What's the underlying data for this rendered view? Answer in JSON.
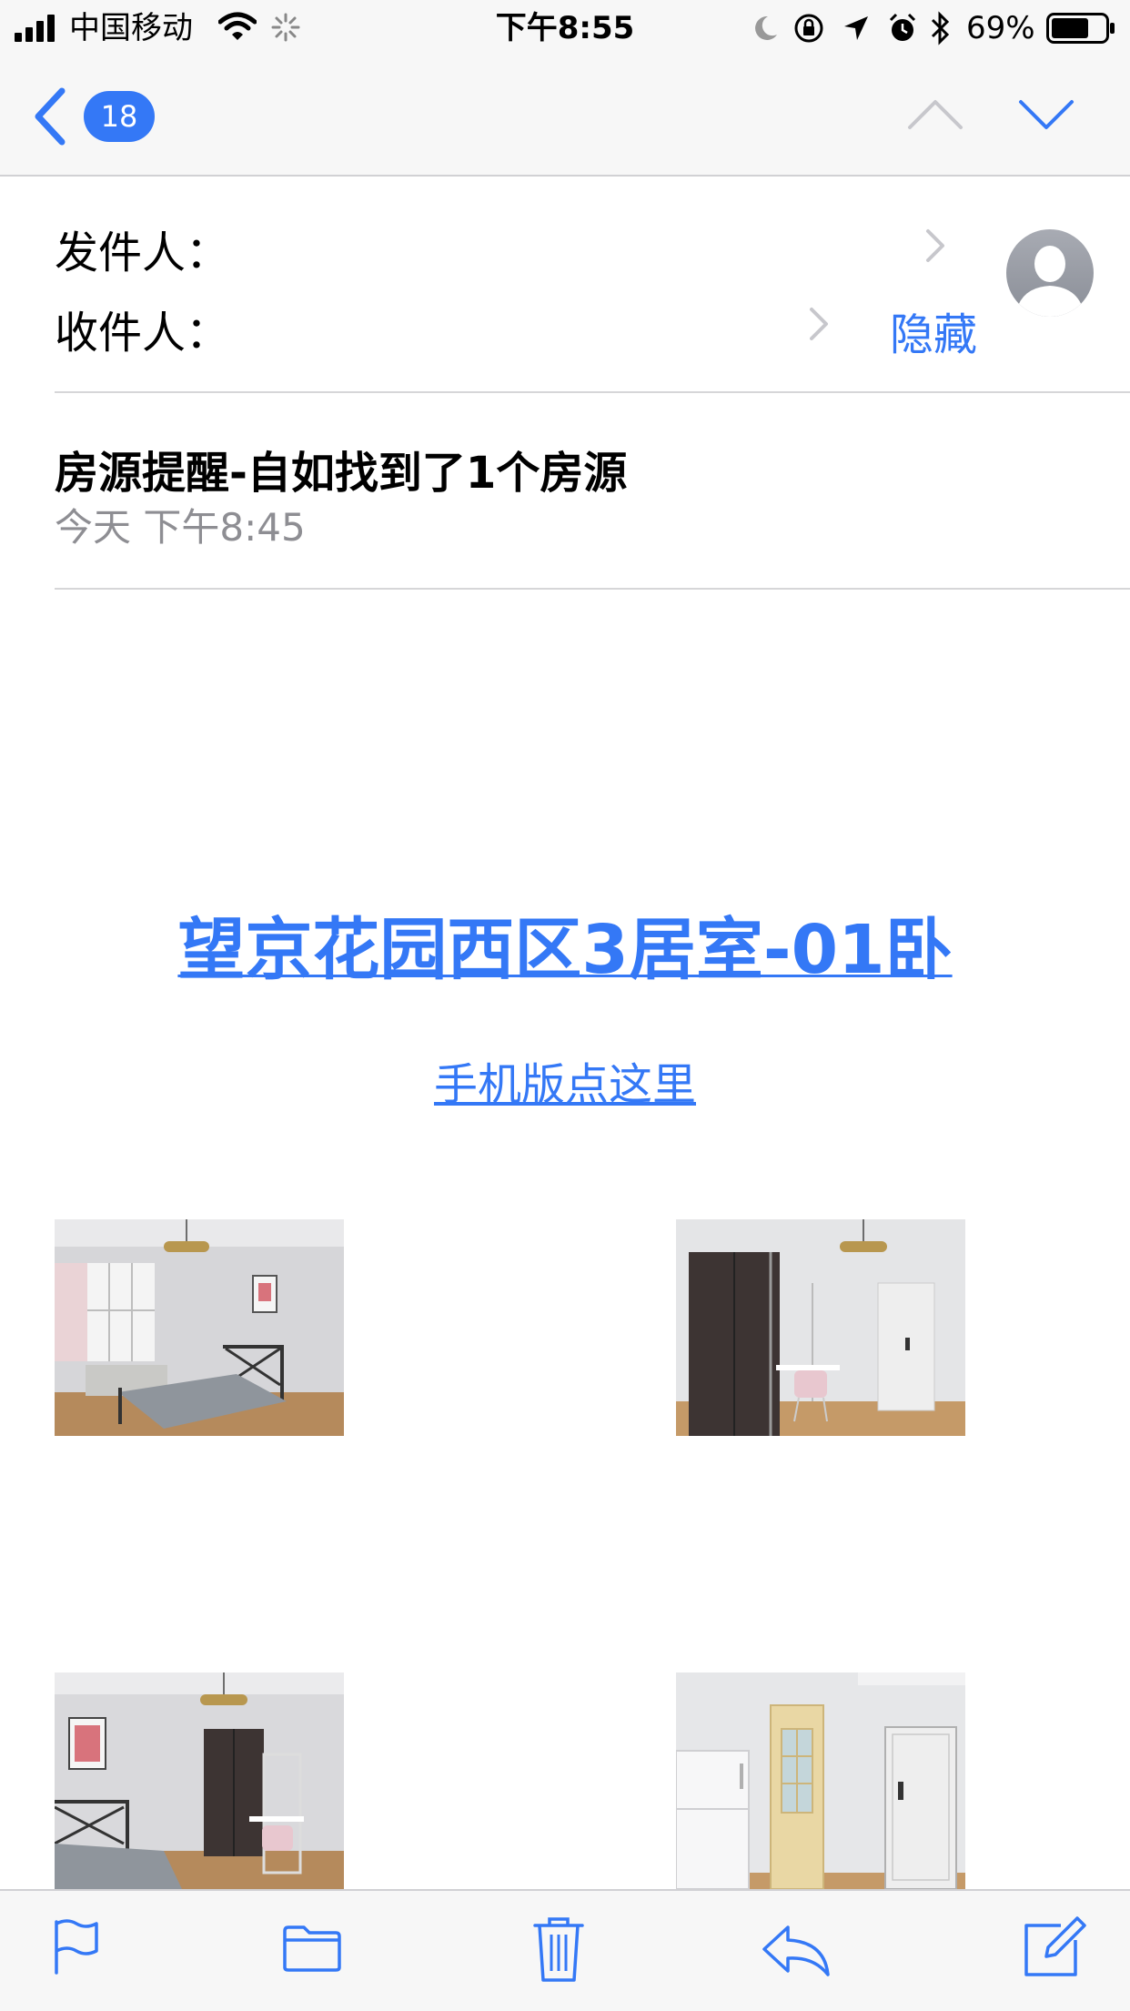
{
  "status_bar": {
    "carrier": "中国移动",
    "time": "下午8:55",
    "battery": "69%",
    "battery_level": 0.69
  },
  "nav": {
    "unread_count": "18",
    "back_icon": "chevron-left-icon",
    "prev_icon": "chevron-up-icon",
    "next_icon": "chevron-down-icon"
  },
  "header": {
    "from_label": "发件人：",
    "to_label": "收件人：",
    "hide_label": "隐藏",
    "avatar_icon": "person-avatar-icon"
  },
  "message": {
    "subject": "房源提醒-自如找到了1个房源",
    "date": "今天 下午8:45"
  },
  "body": {
    "listing_title": "望京花园西区3居室-01卧",
    "mobile_link": "手机版点这里"
  },
  "toolbar": {
    "icons": [
      "flag-icon",
      "folder-icon",
      "trash-icon",
      "reply-icon",
      "compose-icon"
    ]
  },
  "colors": {
    "accent": "#3478f6",
    "secondary_text": "#8e8e93",
    "bar_bg": "#f7f7f7"
  }
}
